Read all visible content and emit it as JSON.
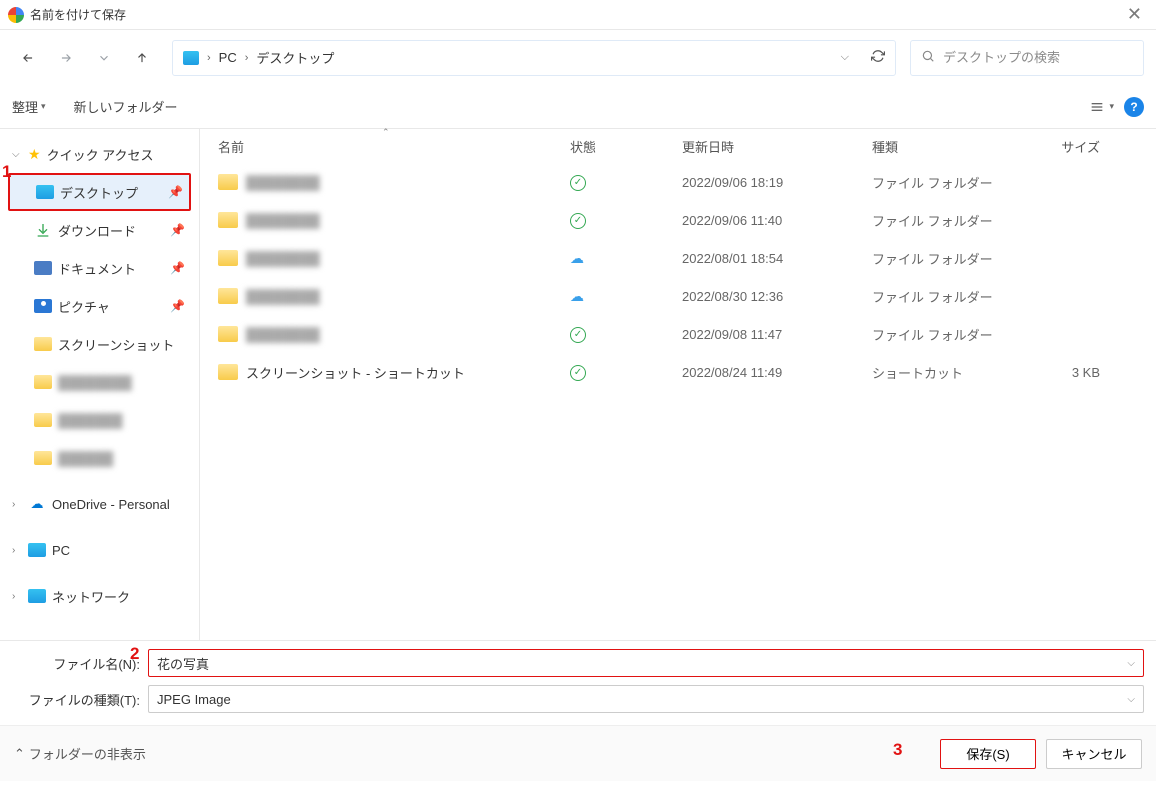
{
  "title": "名前を付けて保存",
  "breadcrumb": {
    "root": "PC",
    "folder": "デスクトップ"
  },
  "search_placeholder": "デスクトップの検索",
  "toolbar": {
    "organize": "整理",
    "new_folder": "新しいフォルダー"
  },
  "annotations": {
    "a1": "1",
    "a2": "2",
    "a3": "3"
  },
  "sidebar": {
    "quick_access": "クイック アクセス",
    "desktop": "デスクトップ",
    "downloads": "ダウンロード",
    "documents": "ドキュメント",
    "pictures": "ピクチャ",
    "screenshots": "スクリーンショット",
    "onedrive": "OneDrive - Personal",
    "pc": "PC",
    "network": "ネットワーク"
  },
  "columns": {
    "name": "名前",
    "status": "状態",
    "date": "更新日時",
    "type": "種類",
    "size": "サイズ"
  },
  "files": [
    {
      "name_blur": true,
      "status": "check",
      "date": "2022/09/06 18:19",
      "type": "ファイル フォルダー",
      "size": ""
    },
    {
      "name_blur": true,
      "status": "check",
      "date": "2022/09/06 11:40",
      "type": "ファイル フォルダー",
      "size": ""
    },
    {
      "name_blur": true,
      "status": "cloud",
      "date": "2022/08/01 18:54",
      "type": "ファイル フォルダー",
      "size": ""
    },
    {
      "name_blur": true,
      "status": "cloud",
      "date": "2022/08/30 12:36",
      "type": "ファイル フォルダー",
      "size": ""
    },
    {
      "name_blur": true,
      "status": "check",
      "date": "2022/09/08 11:47",
      "type": "ファイル フォルダー",
      "size": ""
    },
    {
      "name": "スクリーンショット - ショートカット",
      "status": "check",
      "date": "2022/08/24 11:49",
      "type": "ショートカット",
      "size": "3 KB"
    }
  ],
  "form": {
    "filename_label": "ファイル名(N):",
    "filename_value": "花の写真",
    "filetype_label": "ファイルの種類(T):",
    "filetype_value": "JPEG Image"
  },
  "footer": {
    "toggle_folders": "フォルダーの非表示",
    "save": "保存(S)",
    "cancel": "キャンセル"
  }
}
